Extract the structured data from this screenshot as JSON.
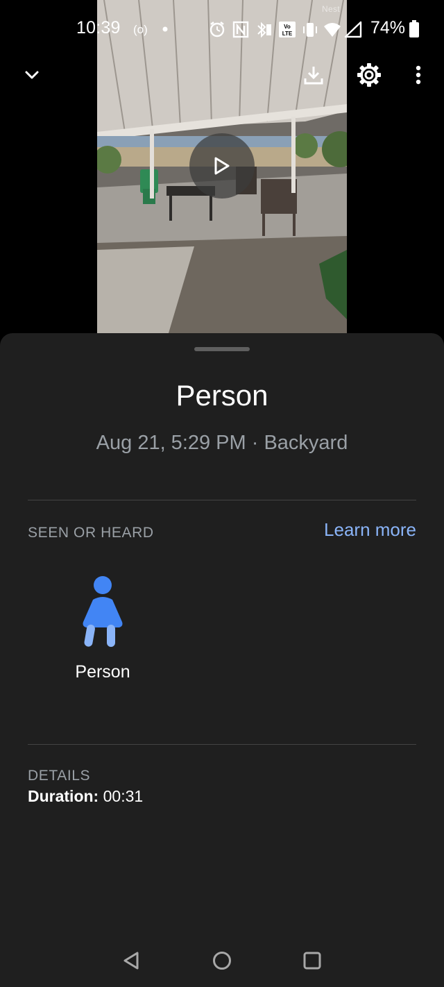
{
  "status_bar": {
    "time": "10:39",
    "battery_percent": "74%",
    "icons": [
      "hotspot-icon",
      "dot-icon",
      "alarm-icon",
      "nfc-icon",
      "bluetooth-battery-icon",
      "volte-icon",
      "vibrate-icon",
      "wifi-icon",
      "signal-icon",
      "battery-icon"
    ]
  },
  "video": {
    "watermark": "Nest",
    "play_icon": "play-icon"
  },
  "toolbar": {
    "collapse_icon": "chevron-down-icon",
    "download_icon": "download-icon",
    "settings_icon": "gear-icon",
    "more_icon": "more-vert-icon"
  },
  "event": {
    "title": "Person",
    "subtitle": "Aug 21, 5:29 PM · Backyard"
  },
  "seen_or_heard": {
    "label": "SEEN OR HEARD",
    "learn_more": "Learn more",
    "items": [
      {
        "label": "Person",
        "icon": "person-icon"
      }
    ]
  },
  "details": {
    "label": "DETAILS",
    "duration_key": "Duration:",
    "duration_value": "00:31"
  },
  "nav_bar": {
    "back_icon": "back-triangle-icon",
    "home_icon": "home-circle-icon",
    "recents_icon": "recents-square-icon"
  },
  "colors": {
    "sheet_background": "#1f1f1f",
    "accent_link": "#8ab4f8",
    "person_icon_blue": "#4285f4",
    "secondary_text": "#9aa0a6"
  }
}
